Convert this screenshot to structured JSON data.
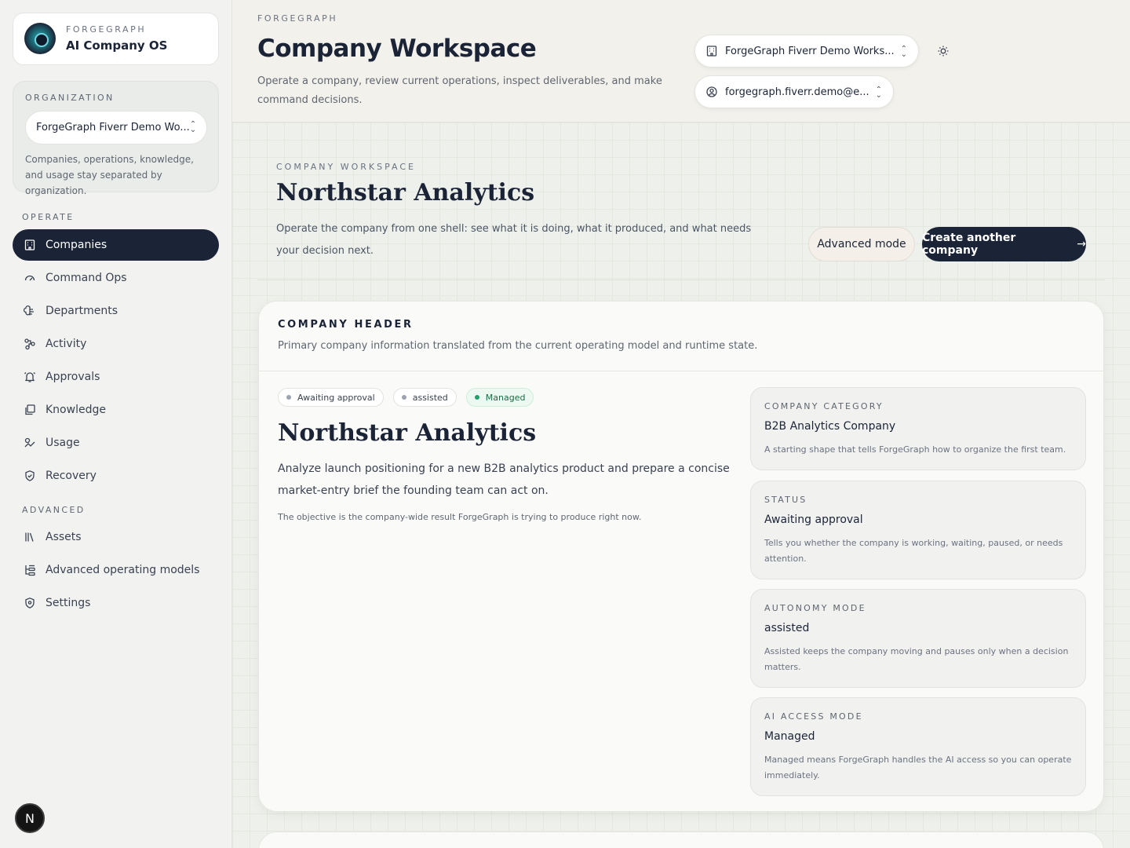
{
  "sidebar": {
    "brand": {
      "kicker": "FORGEGRAPH",
      "name": "AI Company OS"
    },
    "org": {
      "kicker": "ORGANIZATION",
      "selected": "ForgeGraph Fiverr Demo Wo...",
      "help": "Companies, operations, knowledge, and usage stay separated by organization."
    },
    "operate_label": "OPERATE",
    "operate_items": [
      {
        "label": "Companies",
        "icon": "building-icon",
        "active": true
      },
      {
        "label": "Command Ops",
        "icon": "gauge-icon"
      },
      {
        "label": "Departments",
        "icon": "brain-icon"
      },
      {
        "label": "Activity",
        "icon": "workflow-icon"
      },
      {
        "label": "Approvals",
        "icon": "bell-icon"
      },
      {
        "label": "Knowledge",
        "icon": "library-icon"
      },
      {
        "label": "Usage",
        "icon": "usage-icon"
      },
      {
        "label": "Recovery",
        "icon": "shield-check-icon"
      }
    ],
    "advanced_label": "ADVANCED",
    "advanced_items": [
      {
        "label": "Assets",
        "icon": "books-icon"
      },
      {
        "label": "Advanced operating models",
        "icon": "hierarchy-icon"
      },
      {
        "label": "Settings",
        "icon": "shield-icon"
      }
    ],
    "badge": "N"
  },
  "header": {
    "kicker": "FORGEGRAPH",
    "title": "Company Workspace",
    "description": "Operate a company, review current operations, inspect deliverables, and make command decisions.",
    "workspace_select": "ForgeGraph Fiverr Demo Works...",
    "account_select": "forgegraph.fiverr.demo@e..."
  },
  "workspace": {
    "kicker": "COMPANY WORKSPACE",
    "title": "Northstar Analytics",
    "description": "Operate the company from one shell: see what it is doing, what it produced, and what needs your decision next.",
    "advanced_button": "Advanced mode",
    "create_button": "Create another company"
  },
  "company_header": {
    "kicker": "COMPANY HEADER",
    "subtitle": "Primary company information translated from the current operating model and runtime state.",
    "chips": [
      "Awaiting approval",
      "assisted",
      "Managed"
    ],
    "title": "Northstar Analytics",
    "description": "Analyze launch positioning for a new B2B analytics product and prepare a concise market-entry brief the founding team can act on.",
    "note": "The objective is the company-wide result ForgeGraph is trying to produce right now.",
    "info_cards": [
      {
        "kicker": "COMPANY CATEGORY",
        "value": "B2B Analytics Company",
        "desc": "A starting shape that tells ForgeGraph how to organize the first team."
      },
      {
        "kicker": "STATUS",
        "value": "Awaiting approval",
        "desc": "Tells you whether the company is working, waiting, paused, or needs attention."
      },
      {
        "kicker": "AUTONOMY MODE",
        "value": "assisted",
        "desc": "Assisted keeps the company moving and pauses only when a decision matters."
      },
      {
        "kicker": "AI ACCESS MODE",
        "value": "Managed",
        "desc": "Managed means ForgeGraph handles the AI access so you can operate immediately."
      }
    ]
  },
  "colors": {
    "navy": "#1b2436",
    "green": "#22a06b"
  }
}
